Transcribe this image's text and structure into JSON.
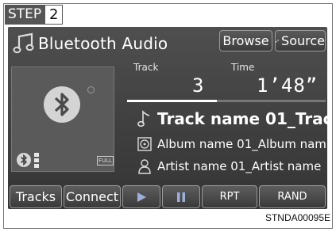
{
  "step": {
    "word": "STEP",
    "number": "2"
  },
  "header": {
    "title": "Bluetooth Audio",
    "browse_label": "Browse",
    "source_label": "Source"
  },
  "playback": {
    "track_label": "Track",
    "time_label": "Time",
    "track_number": "3",
    "elapsed_time": "1’48”",
    "progress_fraction": 0.45
  },
  "media": {
    "track_name": "Track name 01_Track",
    "album_name": "Album name 01_Album nam",
    "artist_name": "Artist name 01_Artist name"
  },
  "album_art": {
    "battery_label": "FULL"
  },
  "controls": {
    "tracks_label": "Tracks",
    "connect_label": "Connect",
    "rpt_label": "RPT",
    "rand_label": "RAND"
  },
  "icons": {
    "title": "music-note-icon",
    "source": "source-icon",
    "art": "bluetooth-icon",
    "status": "bluetooth-icon",
    "signal": "signal-strength-icon",
    "battery": "battery-icon",
    "track": "music-note-icon",
    "album": "album-icon",
    "artist": "artist-icon",
    "play": "play-icon",
    "pause": "pause-icon"
  },
  "colors": {
    "screen_bg": "#454545",
    "text": "#ffffff",
    "button_border": "#9a9a9a"
  },
  "figure_code": "STNDA00095E"
}
